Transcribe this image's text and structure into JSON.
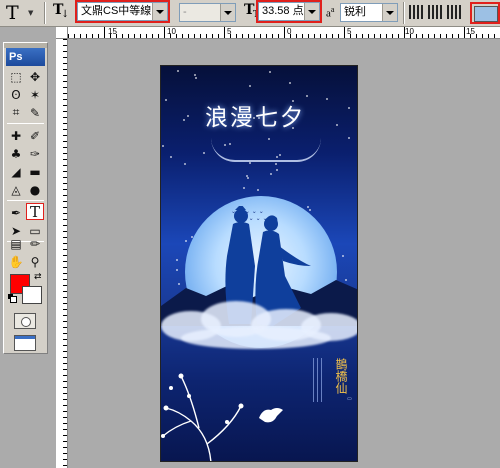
{
  "options_bar": {
    "tool_preset_glyph": "T",
    "orientation_glyph": "T",
    "font_family": "文鼎CS中等線",
    "font_style": "-",
    "font_size_glyph": "T",
    "font_size": "33.58 点",
    "antialias_glyph": "a",
    "antialias_sup": "a",
    "antialias": "锐利",
    "text_color": "#9cc0e4"
  },
  "toolbox": {
    "logo": "Ps",
    "selected_tool": "T",
    "foreground_color": "#ff0000",
    "background_color": "#ffffff"
  },
  "ruler": {
    "labels": [
      "15",
      "10",
      "5",
      "0",
      "5",
      "10",
      "15"
    ]
  },
  "canvas": {
    "title": "浪漫七夕",
    "poem_title": "鵲橋仙"
  }
}
